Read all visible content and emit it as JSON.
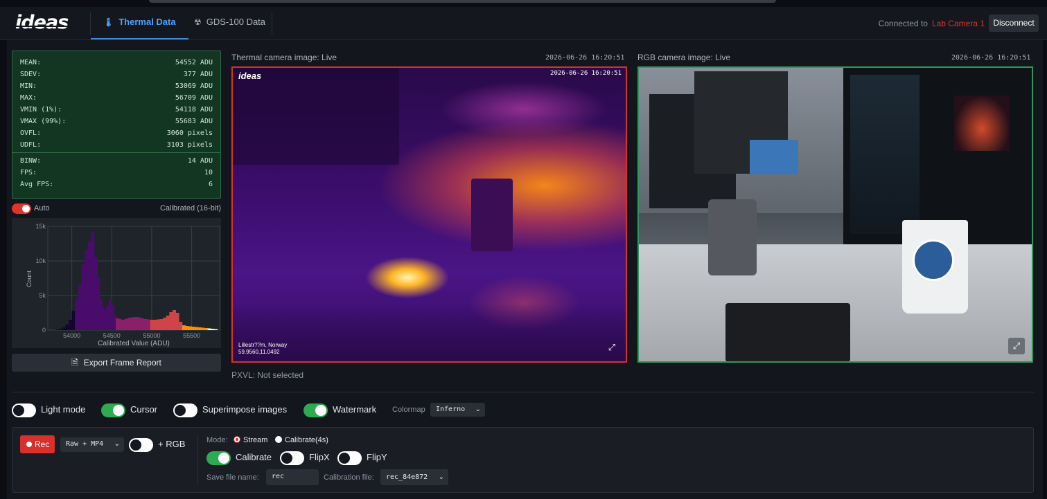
{
  "app": {
    "logo": "ideas"
  },
  "tabs": [
    {
      "label": "Thermal Data",
      "icon": "thermometer-icon",
      "active": true
    },
    {
      "label": "GDS-100 Data",
      "icon": "radiation-icon",
      "active": false
    }
  ],
  "connection": {
    "prefix": "Connected to",
    "camera": "Lab Camera 1",
    "disconnect_label": "Disconnect"
  },
  "stats": {
    "rows": [
      {
        "label": "MEAN:",
        "value": "54552 ADU"
      },
      {
        "label": "SDEV:",
        "value": "377 ADU"
      },
      {
        "label": "MIN:",
        "value": "53069 ADU"
      },
      {
        "label": "MAX:",
        "value": "56709 ADU"
      },
      {
        "label": "VMIN (1%):",
        "value": "54118 ADU"
      },
      {
        "label": "VMAX (99%):",
        "value": "55683 ADU"
      },
      {
        "label": "OVFL:",
        "value": "3060 pixels"
      },
      {
        "label": "UDFL:",
        "value": "3103 pixels"
      }
    ],
    "rows2": [
      {
        "label": "BINW:",
        "value": "14 ADU"
      },
      {
        "label": "FPS:",
        "value": "10"
      },
      {
        "label": "Avg FPS:",
        "value": "6"
      }
    ]
  },
  "auto": {
    "label": "Auto",
    "on": true,
    "calibrated": "Calibrated (16-bit)"
  },
  "chart_data": {
    "type": "bar",
    "title": "",
    "xlabel": "Calibrated Value (ADU)",
    "ylabel": "Count",
    "xlim": [
      53700,
      55850
    ],
    "ylim": [
      0,
      15000
    ],
    "xticks": [
      "54000",
      "54500",
      "55000",
      "55500"
    ],
    "yticks": [
      "0",
      "5k",
      "10k",
      "15k"
    ],
    "grid": true,
    "x": [
      53820,
      53860,
      53900,
      53940,
      53980,
      54020,
      54060,
      54100,
      54140,
      54180,
      54220,
      54260,
      54300,
      54330,
      54360,
      54390,
      54420,
      54450,
      54480,
      54510,
      54540,
      54570,
      54600,
      54640,
      54680,
      54720,
      54760,
      54800,
      54840,
      54880,
      54920,
      54960,
      55000,
      55040,
      55080,
      55120,
      55160,
      55200,
      55240,
      55280,
      55320,
      55360,
      55400,
      55440,
      55480,
      55520,
      55560,
      55600,
      55640,
      55680,
      55720,
      55760,
      55800
    ],
    "values": [
      100,
      200,
      400,
      800,
      1500,
      2800,
      4500,
      6500,
      9500,
      11500,
      12800,
      14200,
      10500,
      7500,
      4500,
      3200,
      2800,
      3500,
      4500,
      3600,
      2200,
      1700,
      1600,
      1500,
      1650,
      1800,
      1850,
      1900,
      1850,
      1700,
      1600,
      1550,
      1500,
      1500,
      1550,
      1600,
      1800,
      2100,
      2600,
      2900,
      2500,
      1200,
      700,
      600,
      550,
      500,
      450,
      400,
      350,
      300,
      250,
      200,
      150
    ]
  },
  "export": {
    "label": "Export Frame Report"
  },
  "thermal": {
    "title": "Thermal camera image: Live",
    "timestamp": "2026-06-26  16:20:51",
    "watermark": "ideas",
    "overlay_ts": "2026-06-26  16:20:51",
    "loc1": "Lillestr??m, Norway",
    "loc2": "59.9560,11.0492"
  },
  "rgb": {
    "title": "RGB camera image: Live",
    "timestamp": "2026-06-26  16:20:51"
  },
  "pxvl": "PXVL: Not selected",
  "options": {
    "light_mode": "Light mode",
    "cursor": "Cursor",
    "superimpose": "Superimpose images",
    "watermark": "Watermark",
    "colormap_label": "Colormap",
    "colormap_value": "Inferno"
  },
  "record": {
    "rec_label": "Rec",
    "format": "Raw + MP4",
    "rgb_label": "+ RGB",
    "mode_label": "Mode:",
    "mode_stream": "Stream",
    "mode_calibrate": "Calibrate(4s)",
    "calibrate": "Calibrate",
    "flipx": "FlipX",
    "flipy": "FlipY",
    "save_label": "Save file name:",
    "save_value": "rec",
    "calfile_label": "Calibration file:",
    "calfile_value": "rec_84e872"
  },
  "colors": {
    "accent": "#3b8fe8",
    "danger": "#d8302b",
    "success": "#2eaa52"
  }
}
